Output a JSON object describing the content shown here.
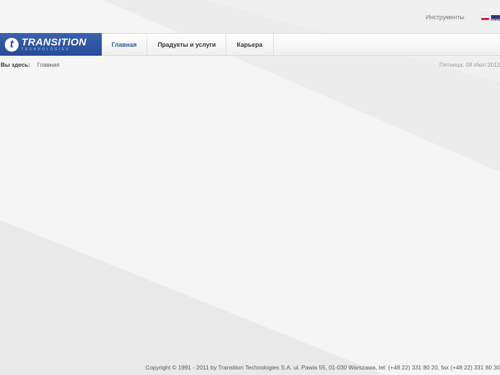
{
  "header": {
    "tools_link": "Инструменты",
    "languages": [
      "pl",
      "en"
    ]
  },
  "logo": {
    "mark": "t",
    "name": "TRANSITION",
    "subtitle": "TECHNOLOGIES"
  },
  "nav": {
    "items": [
      {
        "label": "Главная",
        "active": true
      },
      {
        "label": "Прадукты и услуги",
        "active": false
      },
      {
        "label": "Карьера",
        "active": false
      }
    ]
  },
  "breadcrumb": {
    "label": "Вы здесь:",
    "current": "Главная"
  },
  "date": "Пятница, 08 Июл 2011",
  "footer": {
    "copyright": "Copyright © 1991 - 2011 by Transition Technologies S.A. ul. Pawia 55, 01-030 Warszawa, tel: (+48 22) 331 80 20, fax (+48 22) 331 80 30"
  },
  "colors": {
    "brand_blue": "#2c56a8",
    "background": "#f5f5f5"
  }
}
